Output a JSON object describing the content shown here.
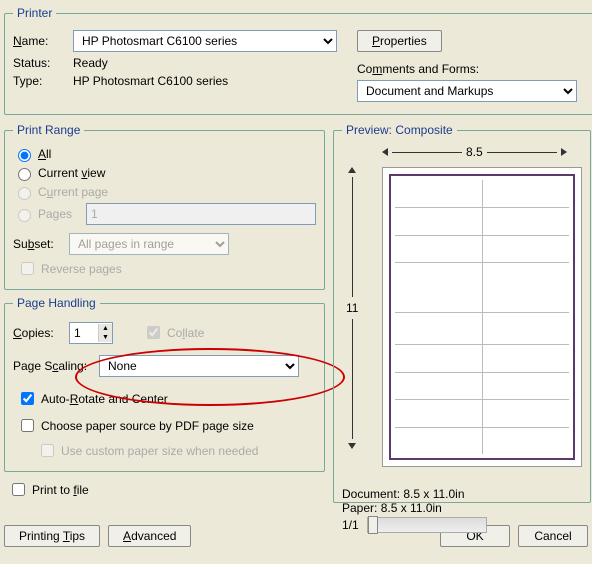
{
  "printer": {
    "legend": "Printer",
    "name_label": "Name:",
    "name_value": "HP Photosmart C6100 series",
    "properties_btn": "Properties",
    "status_label": "Status:",
    "status_value": "Ready",
    "type_label": "Type:",
    "type_value": "HP Photosmart C6100 series",
    "comments_label": "Comments and Forms:",
    "comments_value": "Document and Markups"
  },
  "range": {
    "legend": "Print Range",
    "all": "All",
    "current_view": "Current view",
    "current_page": "Current page",
    "pages": "Pages",
    "pages_value": "1",
    "subset_label": "Subset:",
    "subset_value": "All pages in range",
    "reverse": "Reverse pages"
  },
  "handling": {
    "legend": "Page Handling",
    "copies_label": "Copies:",
    "copies_value": "1",
    "collate": "Collate",
    "scaling_label": "Page Scaling:",
    "scaling_value": "None",
    "auto_rotate": "Auto-Rotate and Center",
    "choose_paper": "Choose paper source by PDF page size",
    "custom_paper": "Use custom paper size when needed"
  },
  "print_to_file": "Print to file",
  "preview": {
    "legend": "Preview: Composite",
    "width": "8.5",
    "height": "11",
    "document": "Document: 8.5 x 11.0in",
    "paper": "Paper: 8.5 x 11.0in",
    "page": "1/1"
  },
  "buttons": {
    "tips": "Printing Tips",
    "advanced": "Advanced",
    "ok": "OK",
    "cancel": "Cancel"
  }
}
